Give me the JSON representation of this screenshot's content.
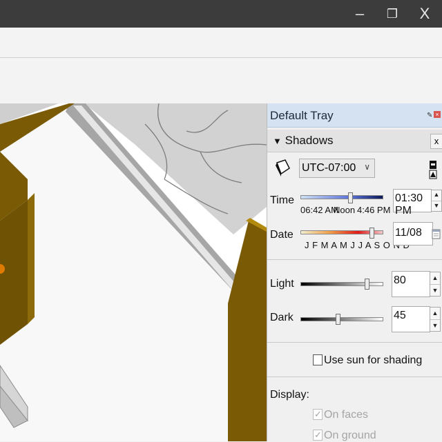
{
  "window": {
    "minimize": "–",
    "restore": "❐",
    "close": "X"
  },
  "tray": {
    "title": "Default Tray"
  },
  "shadows": {
    "title": "Shadows",
    "collapse_glyph": "▼",
    "close_glyph": "x",
    "timezone": "UTC-07:00",
    "time_label": "Time",
    "time_ticks": {
      "sunrise": "06:42 AM",
      "noon": "Noon",
      "sunset": "4:46 PM"
    },
    "time_value": "01:30 PM",
    "time_level": 0.6,
    "date_label": "Date",
    "months": "J F M A M J J A S O N D",
    "date_value": "11/08",
    "date_level": 0.86,
    "light_label": "Light",
    "light_value": "80",
    "light_level": 0.8,
    "dark_label": "Dark",
    "dark_value": "45",
    "dark_level": 0.45,
    "use_sun_label": "Use sun for shading",
    "use_sun_checked": false,
    "display_label": "Display:",
    "on_faces_label": "On faces",
    "on_ground_label": "On ground",
    "on_faces_checked": true,
    "on_ground_checked": true
  },
  "icons": {
    "shadow": "shadow-toggle-icon",
    "panel": "panel-toggle-icon",
    "calendar": "calendar-icon"
  },
  "colors": {
    "titlebar": "#3c3c3c",
    "tray_header": "#d5e2f1",
    "wall": "#7a5a05"
  }
}
